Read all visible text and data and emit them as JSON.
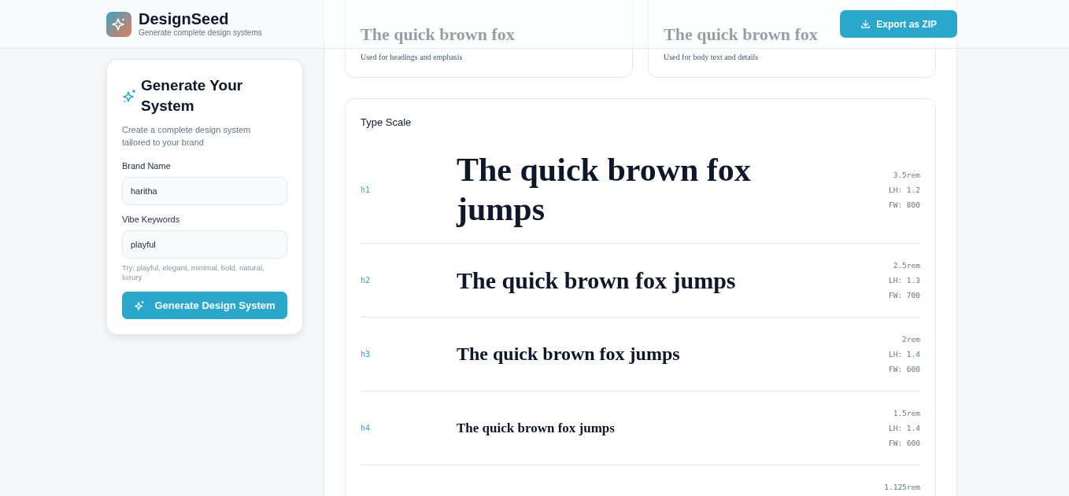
{
  "header": {
    "logo_title": "DesignSeed",
    "logo_subtitle": "Generate complete design systems",
    "export_button": "Export as ZIP"
  },
  "sidebar": {
    "title": "Generate Your System",
    "description": "Create a complete design system tailored to your brand",
    "fields": [
      {
        "label": "Brand Name",
        "value": "haritha"
      },
      {
        "label": "Vibe Keywords",
        "value": "playful",
        "hint": "Try: playful, elegant, minimal, bold, natural, luxury"
      }
    ],
    "button": "Generate Design System"
  },
  "font_cards": [
    {
      "sample": "The quick brown fox",
      "description": "Used for headings and emphasis"
    },
    {
      "sample": "The quick brown fox",
      "description": "Used for body text and details"
    }
  ],
  "type_scale": {
    "title": "Type Scale",
    "rows": [
      {
        "tag": "h1",
        "sample": "The quick brown fox jumps",
        "size": "3.5rem",
        "line_height": "LH: 1.2",
        "weight": "FW: 800"
      },
      {
        "tag": "h2",
        "sample": "The quick brown fox jumps",
        "size": "2.5rem",
        "line_height": "LH: 1.3",
        "weight": "FW: 700"
      },
      {
        "tag": "h3",
        "sample": "The quick brown fox jumps",
        "size": "2rem",
        "line_height": "LH: 1.4",
        "weight": "FW: 600"
      },
      {
        "tag": "h4",
        "sample": "The quick brown fox jumps",
        "size": "1.5rem",
        "line_height": "LH: 1.4",
        "weight": "FW: 600"
      },
      {
        "size": "1.125rem"
      }
    ]
  }
}
